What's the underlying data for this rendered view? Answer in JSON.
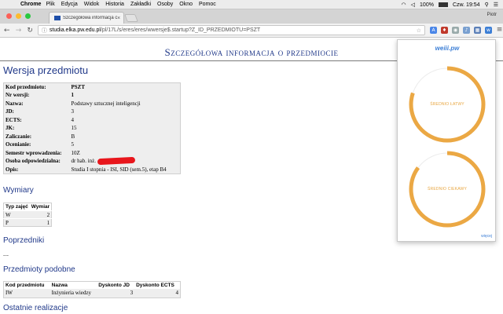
{
  "menubar": {
    "app": "Chrome",
    "items": [
      "Plik",
      "Edycja",
      "Widok",
      "Historia",
      "Zakładki",
      "Osoby",
      "Okno",
      "Pomoc"
    ],
    "battery": "100%",
    "clock": "Czw. 19:54"
  },
  "browser": {
    "tab_title": "Szczegółowa informacja o prze",
    "user": "Piotr",
    "url_host": "studia.elka.pw.edu.pl",
    "url_path": "/pl/17L/s/eres/eres/wwersje$.startup?Z_ID_PRZEDMIOTU=PSZT"
  },
  "page": {
    "title": "Szczegółowa informacja o przedmiocie",
    "h_wersja": "Wersja przedmiotu",
    "info_rows": [
      {
        "k": "Kod przedmiotu:",
        "v": "PSZT"
      },
      {
        "k": "Nr wersji:",
        "v": "1"
      },
      {
        "k": "Nazwa:",
        "v": "Podstawy sztucznej inteligencji"
      },
      {
        "k": "JD:",
        "v": "3"
      },
      {
        "k": "ECTS:",
        "v": "4"
      },
      {
        "k": "JK:",
        "v": "15"
      },
      {
        "k": "Zaliczanie:",
        "v": "B"
      },
      {
        "k": "Ocenianie:",
        "v": "5"
      },
      {
        "k": "Semestr wprowadzenia:",
        "v": "10Z"
      },
      {
        "k": "Osoba odpowiedzialna:",
        "v": "dr hab. inż."
      },
      {
        "k": "Opis:",
        "v": "Studia I stopnia - ISI, SID (sem.5), etap B4"
      }
    ],
    "h_wymiary": "Wymiary",
    "wymiary_headers": [
      "Typ zajęć",
      "Wymiar"
    ],
    "wymiary_rows": [
      [
        "W",
        "2"
      ],
      [
        "P",
        "1"
      ]
    ],
    "h_poprzedniki": "Poprzedniki",
    "poprzedniki_empty": "---",
    "h_podobne": "Przedmioty podobne",
    "podobne_headers": [
      "Kod przedmiotu",
      "Nazwa",
      "Dyskonto JD",
      "Dyskonto ECTS"
    ],
    "podobne_rows": [
      [
        "IW",
        "Inżynieria wiedzy",
        "3",
        "4"
      ]
    ],
    "h_ostatnie": "Ostatnie realizacje"
  },
  "popup": {
    "logo": "weiii.pw",
    "gauges": [
      {
        "label": "ŚREDNIO ŁATWY",
        "level": 0.8
      },
      {
        "label": "ŚREDNIO CIEKAWY",
        "level": 0.85
      }
    ],
    "more_link": "więcej",
    "accent": "#eba844",
    "track": "#ececec"
  }
}
